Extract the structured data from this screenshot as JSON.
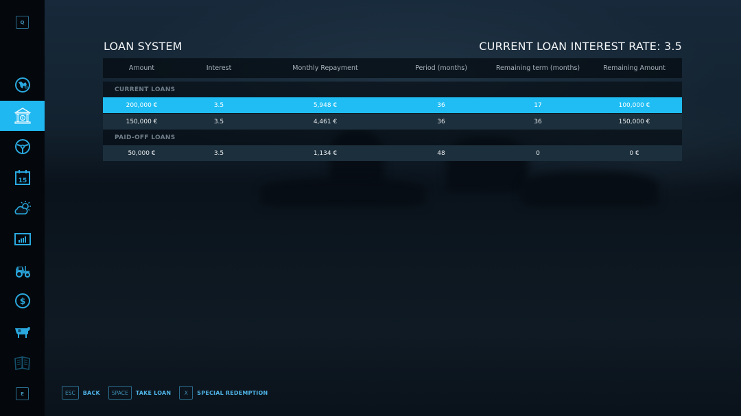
{
  "header": {
    "title": "LOAN SYSTEM",
    "interest_rate_label": "CURRENT LOAN INTEREST RATE: 3.5"
  },
  "sidebar": {
    "top_key": "Q",
    "bottom_key": "E",
    "items": [
      {
        "icon": "globe-map-icon",
        "active": false
      },
      {
        "icon": "bank-icon",
        "active": true
      },
      {
        "icon": "steering-wheel-icon",
        "active": false
      },
      {
        "icon": "calendar-icon",
        "active": false,
        "label": "15"
      },
      {
        "icon": "weather-icon",
        "active": false
      },
      {
        "icon": "statistics-icon",
        "active": false
      },
      {
        "icon": "tractor-icon",
        "active": false
      },
      {
        "icon": "dollar-coin-icon",
        "active": false
      },
      {
        "icon": "cow-icon",
        "active": false
      },
      {
        "icon": "documents-icon",
        "active": false
      }
    ]
  },
  "table": {
    "columns": [
      "Amount",
      "Interest",
      "Monthly Repayment",
      "Period (months)",
      "Remaining term (months)",
      "Remaining Amount"
    ],
    "sections": [
      {
        "title": "CURRENT LOANS",
        "rows": [
          {
            "amount": "200,000 €",
            "interest": "3.5",
            "monthly": "5,948 €",
            "period": "36",
            "remaining_term": "17",
            "remaining_amount": "100,000 €",
            "selected": true
          },
          {
            "amount": "150,000 €",
            "interest": "3.5",
            "monthly": "4,461 €",
            "period": "36",
            "remaining_term": "36",
            "remaining_amount": "150,000 €",
            "selected": false
          }
        ]
      },
      {
        "title": "PAID-OFF LOANS",
        "rows": [
          {
            "amount": "50,000 €",
            "interest": "3.5",
            "monthly": "1,134 €",
            "period": "48",
            "remaining_term": "0",
            "remaining_amount": "0 €",
            "selected": false
          }
        ]
      }
    ]
  },
  "footer": {
    "actions": [
      {
        "key": "ESC",
        "label": "BACK"
      },
      {
        "key": "SPACE",
        "label": "TAKE LOAN"
      },
      {
        "key": "X",
        "label": "SPECIAL REDEMPTION"
      }
    ]
  },
  "colors": {
    "accent": "#1fbdf4",
    "sidebar_bg": "#04080c",
    "row_bg": "#1c2f3c",
    "key_border": "#2b6d8f"
  }
}
